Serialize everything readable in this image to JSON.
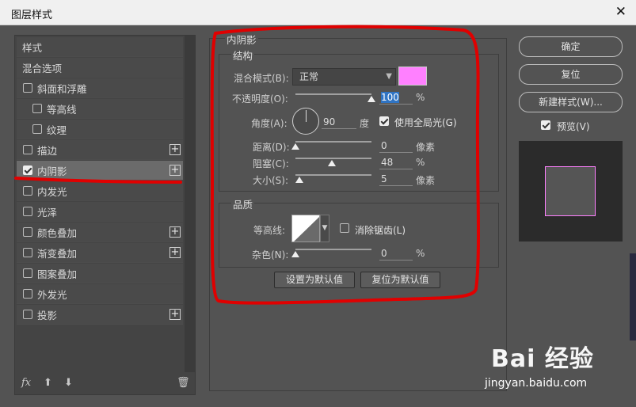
{
  "window": {
    "title": "图层样式",
    "close_label": "✕"
  },
  "styles_list": {
    "items": [
      {
        "label": "样式",
        "checkbox": false,
        "checked": false,
        "plus": false
      },
      {
        "label": "混合选项",
        "checkbox": false,
        "checked": false,
        "plus": false
      },
      {
        "label": "斜面和浮雕",
        "checkbox": true,
        "checked": false,
        "plus": false
      },
      {
        "label": "等高线",
        "checkbox": true,
        "checked": false,
        "plus": false
      },
      {
        "label": "纹理",
        "checkbox": true,
        "checked": false,
        "plus": false
      },
      {
        "label": "描边",
        "checkbox": true,
        "checked": false,
        "plus": true
      },
      {
        "label": "内阴影",
        "checkbox": true,
        "checked": true,
        "plus": true
      },
      {
        "label": "内发光",
        "checkbox": true,
        "checked": false,
        "plus": false
      },
      {
        "label": "光泽",
        "checkbox": true,
        "checked": false,
        "plus": false
      },
      {
        "label": "颜色叠加",
        "checkbox": true,
        "checked": false,
        "plus": true
      },
      {
        "label": "渐变叠加",
        "checkbox": true,
        "checked": false,
        "plus": true
      },
      {
        "label": "图案叠加",
        "checkbox": true,
        "checked": false,
        "plus": false
      },
      {
        "label": "外发光",
        "checkbox": true,
        "checked": false,
        "plus": false
      },
      {
        "label": "投影",
        "checkbox": true,
        "checked": false,
        "plus": true
      }
    ],
    "plus_glyph": "+",
    "bottom_icons": {
      "fx": "fx",
      "up": "⬆",
      "down": "⬇",
      "trash": "🗑"
    }
  },
  "inner_shadow": {
    "section_title": "内阴影",
    "structure": {
      "title": "结构",
      "blend_mode_label": "混合模式(B):",
      "blend_mode_value": "正常",
      "color": "#ff80ff",
      "opacity_label": "不透明度(O):",
      "opacity_value": "100",
      "opacity_unit": "%",
      "angle_label": "角度(A):",
      "angle_value": "90",
      "angle_unit": "度",
      "global_light_label": "使用全局光(G)",
      "global_light_checked": true,
      "distance_label": "距离(D):",
      "distance_value": "0",
      "distance_unit": "像素",
      "choke_label": "阻塞(C):",
      "choke_value": "48",
      "choke_unit": "%",
      "size_label": "大小(S):",
      "size_value": "5",
      "size_unit": "像素"
    },
    "quality": {
      "title": "品质",
      "contour_label": "等高线:",
      "antialias_label": "消除锯齿(L)",
      "antialias_checked": false,
      "noise_label": "杂色(N):",
      "noise_value": "0",
      "noise_unit": "%"
    },
    "set_default_label": "设置为默认值",
    "reset_default_label": "复位为默认值"
  },
  "right_panel": {
    "ok_label": "确定",
    "reset_label": "复位",
    "new_style_label": "新建样式(W)...",
    "preview_label": "预览(V)",
    "preview_checked": true
  },
  "watermark": {
    "brand": "Bai 经验",
    "url": "jingyan.baidu.com"
  },
  "colors": {
    "accent_color": "#ff80ff",
    "annotation": "#e00000"
  }
}
